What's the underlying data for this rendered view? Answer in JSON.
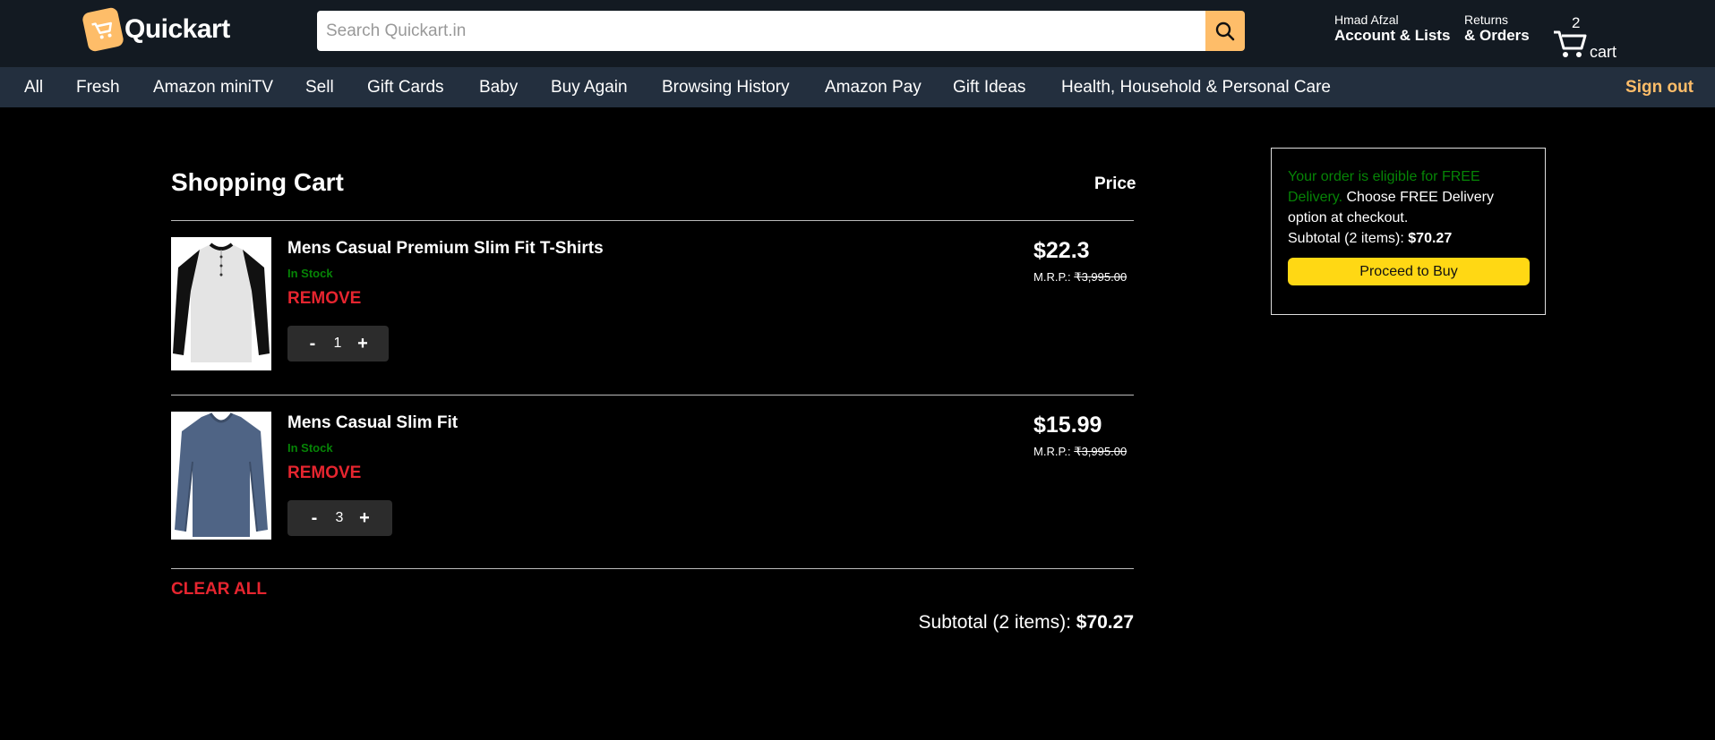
{
  "header": {
    "logo_text": "Quickart",
    "search_placeholder": "Search Quickart.in",
    "account_greeting": "Hmad Afzal",
    "account_label": "Account & Lists",
    "returns_label": "Returns",
    "orders_label": "& Orders",
    "cart_count": "2",
    "cart_label": "cart",
    "accent_color": "#febd69"
  },
  "nav": {
    "items": [
      "All",
      "Fresh",
      "Amazon miniTV",
      "Sell",
      "Gift Cards",
      "Baby",
      "Buy Again",
      "Browsing History",
      "Amazon Pay",
      "Gift Ideas",
      "Health, Household & Personal Care"
    ],
    "sign_out": "Sign out"
  },
  "cart": {
    "title": "Shopping Cart",
    "price_header": "Price",
    "items": [
      {
        "name": "Mens Casual Premium Slim Fit T-Shirts",
        "stock": "In Stock",
        "remove": "REMOVE",
        "qty": "1",
        "price": "$22.3",
        "mrp_label": "M.R.P.:",
        "mrp_value": "₹3,995.00"
      },
      {
        "name": "Mens Casual Slim Fit",
        "stock": "In Stock",
        "remove": "REMOVE",
        "qty": "3",
        "price": "$15.99",
        "mrp_label": "M.R.P.:",
        "mrp_value": "₹3,995.00"
      }
    ],
    "qty_minus": "-",
    "qty_plus": "+",
    "clear_all": "CLEAR ALL",
    "subtotal_label": "Subtotal (2 items):",
    "subtotal_value": "$70.27"
  },
  "checkout": {
    "free_text": "Your order is eligible for FREE Delivery.",
    "choose_text": "Choose FREE Delivery option at checkout.",
    "subtotal_label": "Subtotal (2 items):",
    "subtotal_value": "$70.27",
    "proceed_label": "Proceed to Buy"
  }
}
